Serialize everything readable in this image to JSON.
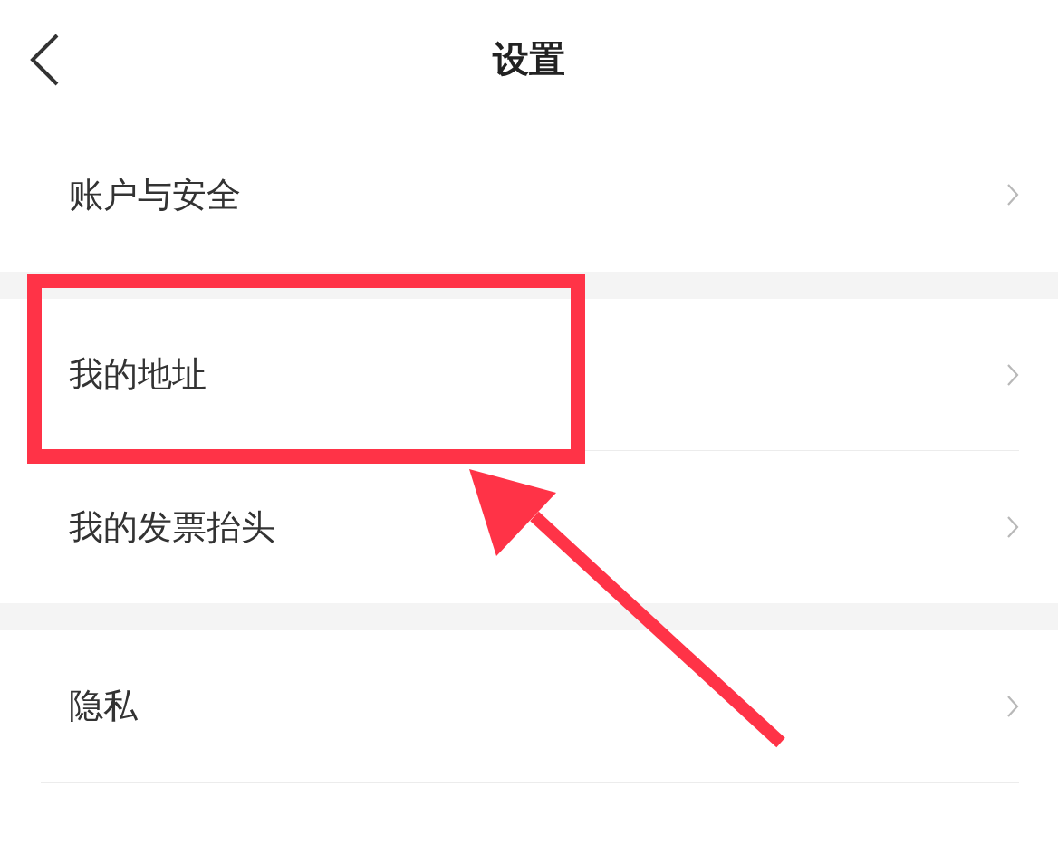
{
  "header": {
    "title": "设置"
  },
  "sections": [
    {
      "items": [
        {
          "label": "账户与安全"
        }
      ]
    },
    {
      "items": [
        {
          "label": "我的地址"
        },
        {
          "label": "我的发票抬头"
        }
      ]
    },
    {
      "items": [
        {
          "label": "隐私"
        }
      ]
    }
  ],
  "annotations": [
    {
      "kind": "box"
    },
    {
      "kind": "arrow"
    }
  ]
}
